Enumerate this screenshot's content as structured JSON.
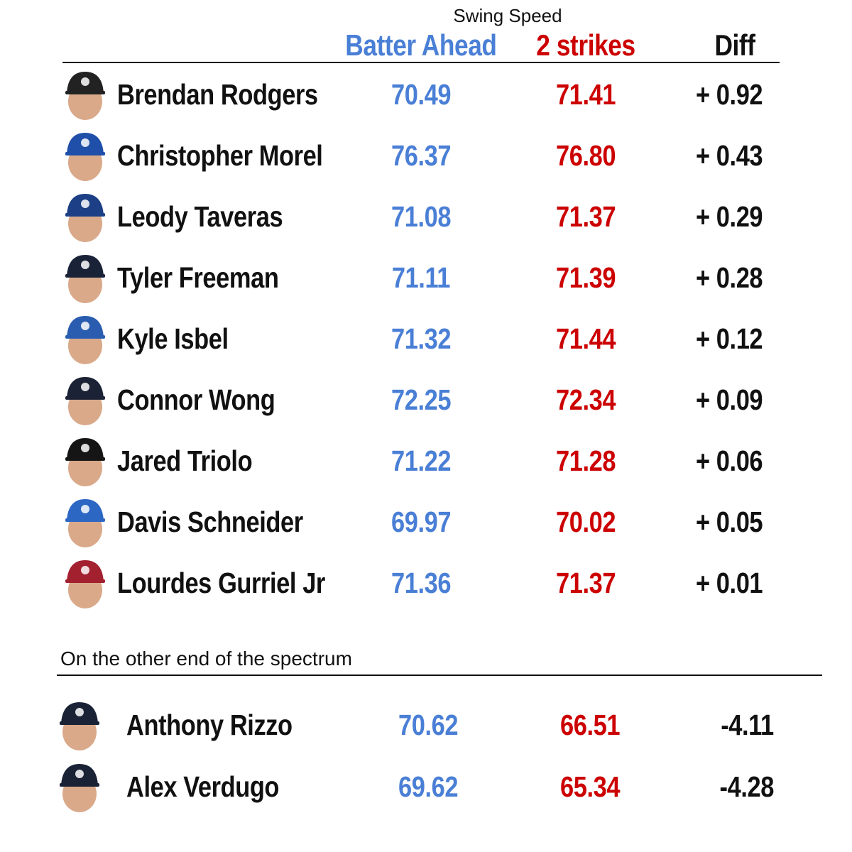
{
  "title": "Swing Speed",
  "columns": {
    "batter_ahead": "Batter Ahead",
    "two_strikes": "2 strikes",
    "diff": "Diff"
  },
  "colors": {
    "batter_ahead": "#4a7fd6",
    "two_strikes": "#cc0000",
    "diff": "#111111"
  },
  "section_label": "On the other end of the spectrum",
  "chart_data": {
    "type": "table",
    "title": "Swing Speed",
    "columns": [
      "Player",
      "Batter Ahead",
      "2 strikes",
      "Diff"
    ],
    "top_rows": [
      {
        "player": "Brendan Rodgers",
        "cap_icon": "rockies-cap",
        "batter_ahead": "70.49",
        "two_strikes": "71.41",
        "diff": "+ 0.92"
      },
      {
        "player": "Christopher Morel",
        "cap_icon": "cubs-cap",
        "batter_ahead": "76.37",
        "two_strikes": "76.80",
        "diff": "+ 0.43"
      },
      {
        "player": "Leody Taveras",
        "cap_icon": "rangers-cap",
        "batter_ahead": "71.08",
        "two_strikes": "71.37",
        "diff": "+ 0.29"
      },
      {
        "player": "Tyler Freeman",
        "cap_icon": "guardians-cap",
        "batter_ahead": "71.11",
        "two_strikes": "71.39",
        "diff": "+ 0.28"
      },
      {
        "player": "Kyle Isbel",
        "cap_icon": "royals-cap",
        "batter_ahead": "71.32",
        "two_strikes": "71.44",
        "diff": "+ 0.12"
      },
      {
        "player": "Connor Wong",
        "cap_icon": "red-sox-cap",
        "batter_ahead": "72.25",
        "two_strikes": "72.34",
        "diff": "+ 0.09"
      },
      {
        "player": "Jared Triolo",
        "cap_icon": "pirates-cap",
        "batter_ahead": "71.22",
        "two_strikes": "71.28",
        "diff": "+ 0.06"
      },
      {
        "player": "Davis Schneider",
        "cap_icon": "blue-jays-cap",
        "batter_ahead": "69.97",
        "two_strikes": "70.02",
        "diff": "+ 0.05"
      },
      {
        "player": "Lourdes Gurriel Jr",
        "cap_icon": "diamondbacks-cap",
        "batter_ahead": "71.36",
        "two_strikes": "71.37",
        "diff": "+ 0.01"
      }
    ],
    "bottom_rows": [
      {
        "player": "Anthony Rizzo",
        "cap_icon": "yankees-cap",
        "batter_ahead": "70.62",
        "two_strikes": "66.51",
        "diff": "-4.11"
      },
      {
        "player": "Alex Verdugo",
        "cap_icon": "yankees-cap",
        "batter_ahead": "69.62",
        "two_strikes": "65.34",
        "diff": "-4.28"
      }
    ]
  },
  "cap_colors": {
    "rockies-cap": "#222222",
    "cubs-cap": "#1f4fa8",
    "rangers-cap": "#1c3f85",
    "guardians-cap": "#1a2238",
    "royals-cap": "#2a5db0",
    "red-sox-cap": "#1b2235",
    "pirates-cap": "#151515",
    "blue-jays-cap": "#2d67c4",
    "diamondbacks-cap": "#a3202f",
    "yankees-cap": "#1a2235"
  }
}
